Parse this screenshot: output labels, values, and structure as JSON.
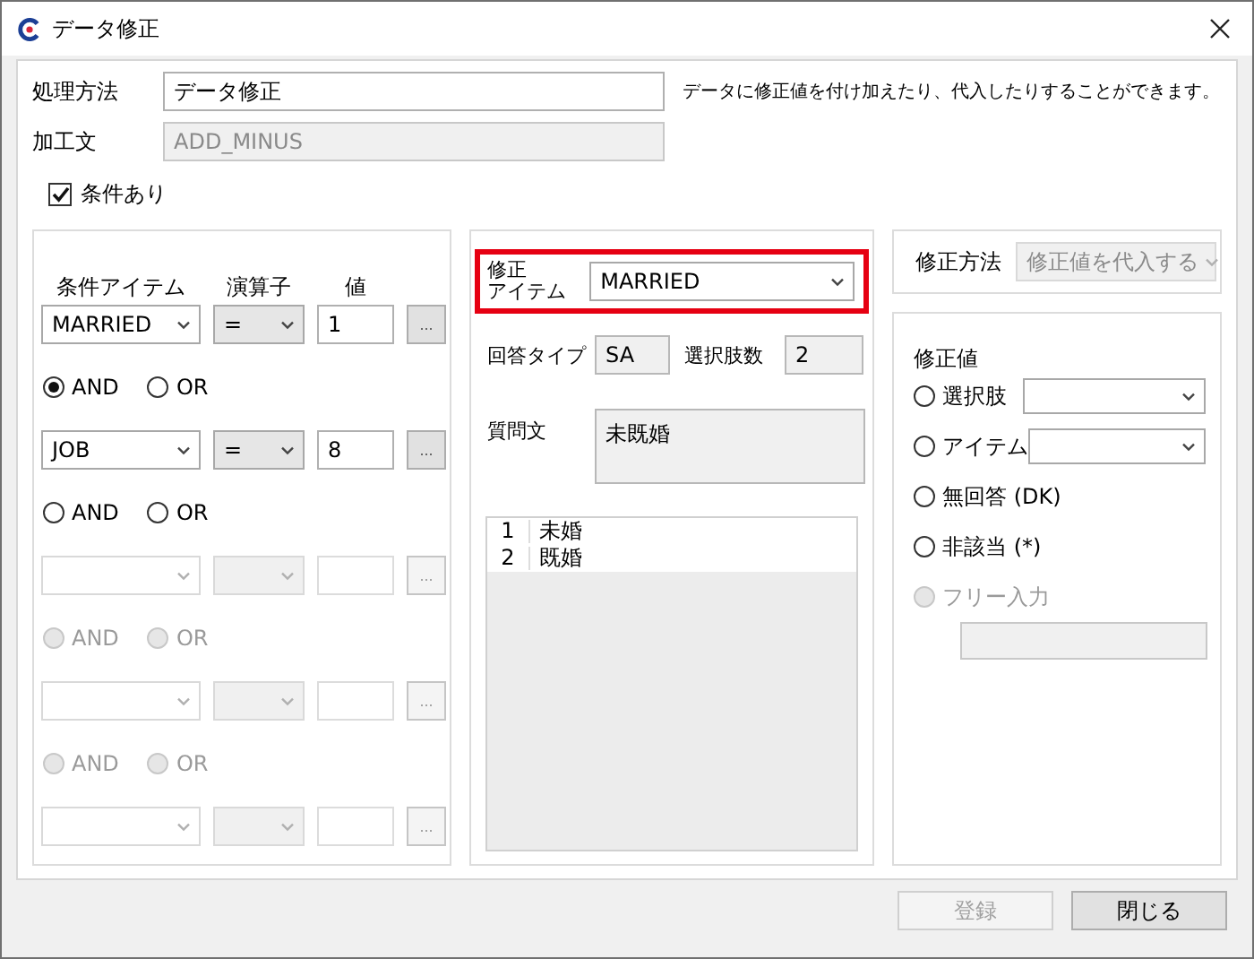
{
  "window": {
    "title": "データ修正"
  },
  "processing": {
    "method_label": "処理方法",
    "method_value": "データ修正",
    "statement_label": "加工文",
    "statement_value": "ADD_MINUS",
    "statement_disabled": true,
    "description": "データに修正値を付け加えたり、代入したりすることができます。"
  },
  "condition_checkbox": {
    "label": "条件あり",
    "checked": true
  },
  "conditions": {
    "headers": [
      "条件アイテム",
      "演算子",
      "値"
    ],
    "rows": [
      {
        "item": "MARRIED",
        "operator": "=",
        "value": "1",
        "button": "...",
        "disabled": false
      },
      {
        "item": "JOB",
        "operator": "=",
        "value": "8",
        "button": "...",
        "disabled": false
      },
      {
        "button": "...",
        "disabled": true
      },
      {
        "button": "...",
        "disabled": true
      },
      {
        "button": "...",
        "disabled": true
      }
    ],
    "connectors": [
      {
        "disabled": false,
        "options": [
          {
            "label": "AND",
            "selected": true
          },
          {
            "label": "OR",
            "selected": false
          }
        ]
      },
      {
        "disabled": false,
        "options": [
          {
            "label": "AND",
            "selected": false
          },
          {
            "label": "OR",
            "selected": false
          }
        ]
      },
      {
        "disabled": true,
        "options": [
          {
            "label": "AND",
            "selected": false
          },
          {
            "label": "OR",
            "selected": false
          }
        ]
      },
      {
        "disabled": true,
        "options": [
          {
            "label": "AND",
            "selected": false
          },
          {
            "label": "OR",
            "selected": false
          }
        ]
      }
    ]
  },
  "target": {
    "label_lines": [
      "修正",
      "アイテム"
    ],
    "value": "MARRIED",
    "highlighted": true,
    "answer_type_label": "回答タイプ",
    "answer_type": "SA",
    "choice_count_label": "選択肢数",
    "choice_count": "2",
    "question_label": "質問文",
    "question": "未既婚",
    "choices": [
      {
        "number": "1",
        "label": "未婚"
      },
      {
        "number": "2",
        "label": "既婚"
      }
    ]
  },
  "method": {
    "label": "修正方法",
    "value": "修正値を代入する",
    "disabled": true
  },
  "correction": {
    "title": "修正値",
    "options": [
      {
        "kind": "dropdown",
        "label": "選択肢",
        "selected": false,
        "disabled": false
      },
      {
        "kind": "dropdown",
        "label": "アイテム",
        "selected": false,
        "disabled": false
      },
      {
        "kind": "plain",
        "label": "無回答 (DK)",
        "selected": false,
        "disabled": false
      },
      {
        "kind": "plain",
        "label": "非該当 (*)",
        "selected": false,
        "disabled": false
      },
      {
        "kind": "text",
        "label": "フリー入力",
        "selected": false,
        "disabled": true
      }
    ]
  },
  "buttons": [
    {
      "label": "登録",
      "disabled": true
    },
    {
      "label": "閉じる",
      "disabled": false
    }
  ]
}
